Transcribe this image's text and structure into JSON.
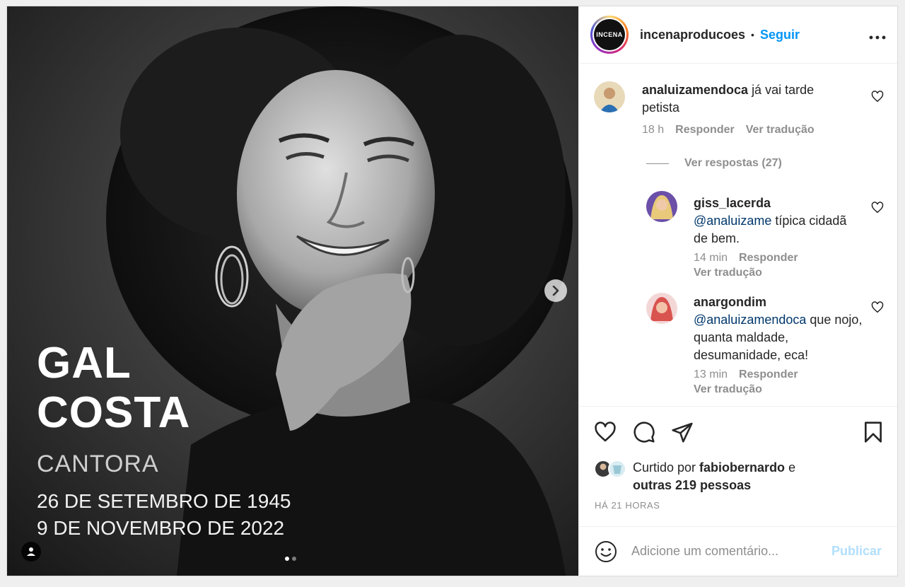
{
  "post": {
    "overlay": {
      "name_line1": "GAL",
      "name_line2": "COSTA",
      "role": "CANTORA",
      "birth": "26 DE SETEMBRO DE 1945",
      "death": "9 DE NOVEMBRO DE 2022"
    },
    "carousel_current": 1,
    "carousel_total": 2
  },
  "header": {
    "logo_text": "INCENA",
    "username": "incenaproducoes",
    "separator": "•",
    "follow_label": "Seguir",
    "more_label": "•••"
  },
  "comments": [
    {
      "username": "analuizamendoca",
      "text": "já vai tarde petista",
      "time": "18 h",
      "reply_label": "Responder",
      "translate_label": "Ver tradução",
      "view_replies_label": "Ver respostas (27)"
    },
    {
      "username": "giss_lacerda",
      "mention": "@analuizame",
      "text": " típica cidadã de bem.",
      "time": "14 min",
      "reply_label": "Responder",
      "translate_label": "Ver tradução"
    },
    {
      "username": "anargondim",
      "mention": "@analuizamendoca",
      "text": " que nojo, quanta maldade, desumanidade, eca!",
      "time": "13 min",
      "reply_label": "Responder",
      "translate_label": "Ver tradução"
    }
  ],
  "likes": {
    "prefix": "Curtido por ",
    "user": "fabiobernardo",
    "middle": " e",
    "others": "outras 219 pessoas"
  },
  "time_ago": "HÁ 21 HORAS",
  "comment_box": {
    "placeholder": "Adicione um comentário...",
    "publish_label": "Publicar"
  },
  "icons": [
    "heart-icon",
    "comment-icon",
    "share-icon",
    "bookmark-icon",
    "emoji-icon",
    "chevron-right-icon",
    "user-tag-icon",
    "more-icon"
  ]
}
